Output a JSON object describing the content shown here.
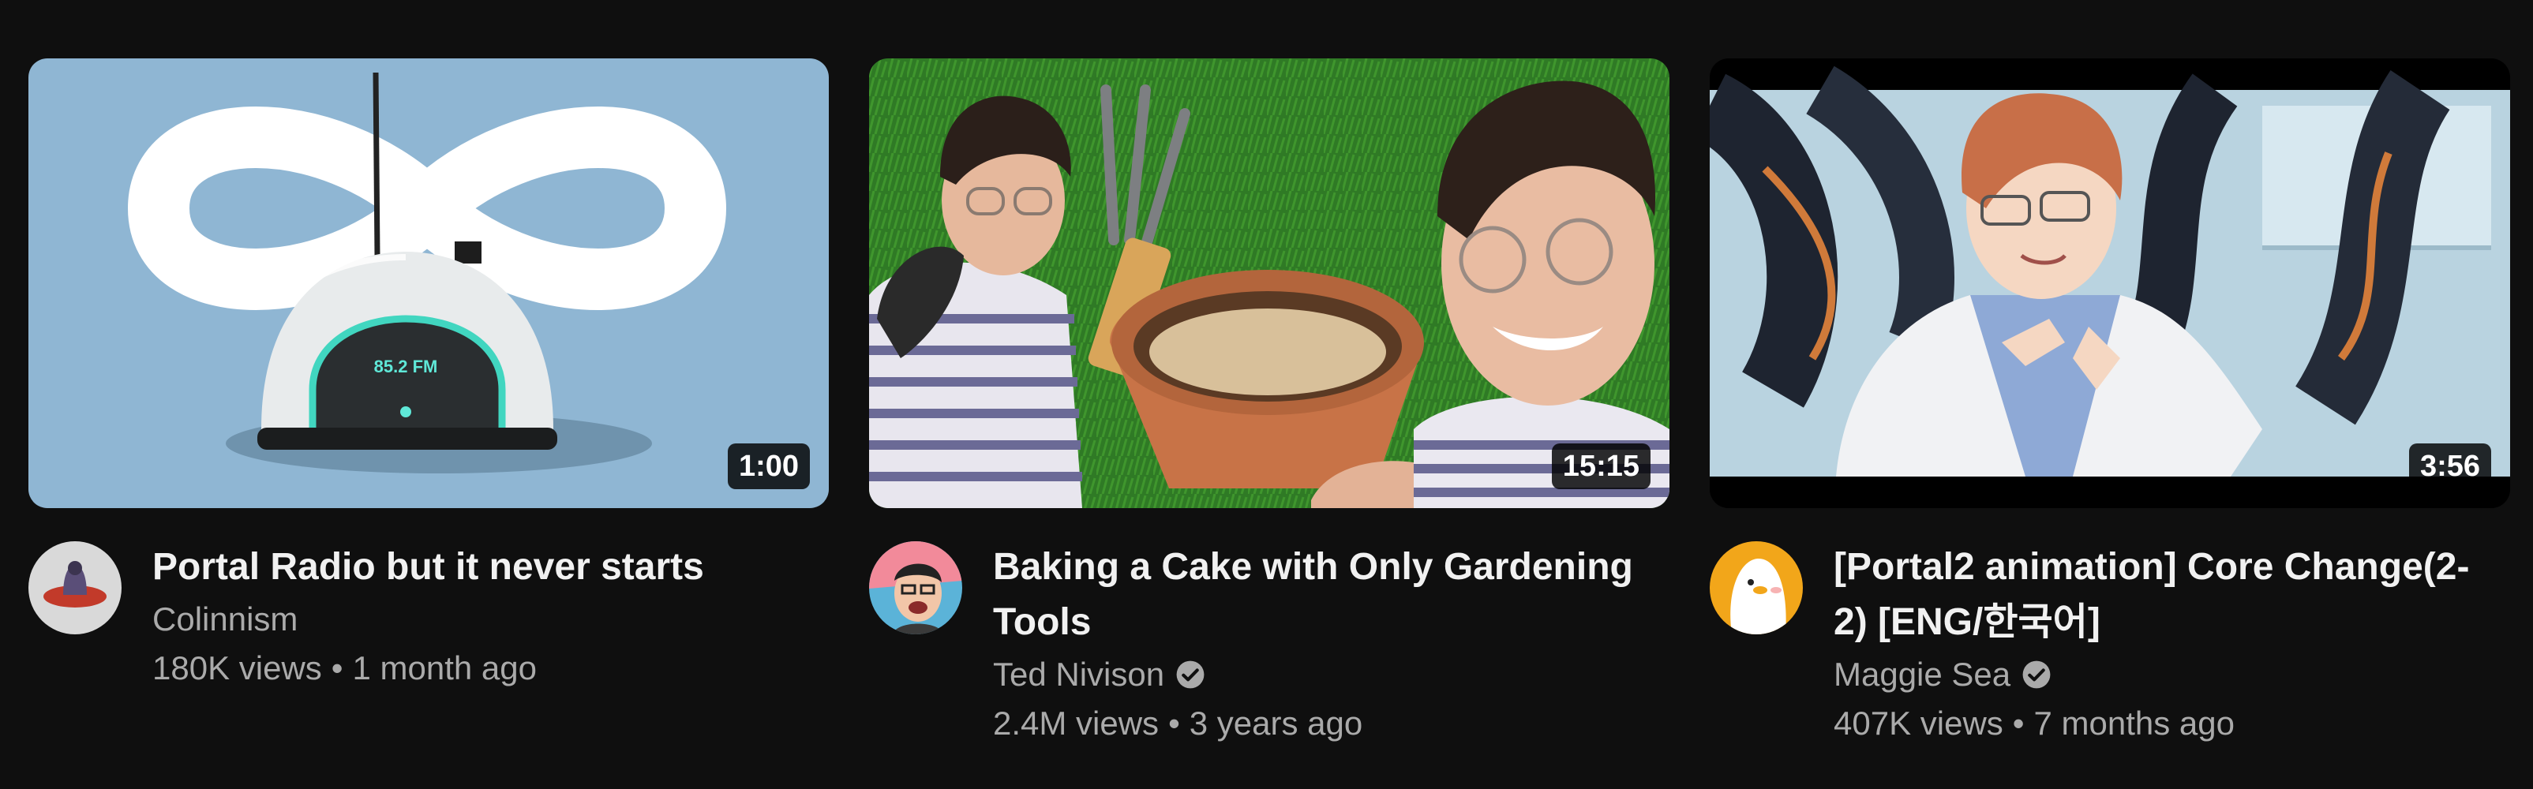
{
  "videos": [
    {
      "title": "Portal Radio but it never starts",
      "channel": "Colinnism",
      "verified": false,
      "views": "180K views",
      "age": "1 month ago",
      "duration": "1:00",
      "thumb_text": "85.2 FM"
    },
    {
      "title": "Baking a Cake with Only Gardening Tools",
      "channel": "Ted Nivison",
      "verified": true,
      "views": "2.4M views",
      "age": "3 years ago",
      "duration": "15:15"
    },
    {
      "title": "[Portal2 animation] Core Change(2-2) [ENG/한국어]",
      "channel": "Maggie Sea",
      "verified": true,
      "views": "407K views",
      "age": "7 months ago",
      "duration": "3:56"
    }
  ],
  "separator": "•",
  "colors": {
    "background": "#0f0f0f",
    "title": "#f1f1f1",
    "secondary": "#aaaaaa"
  }
}
